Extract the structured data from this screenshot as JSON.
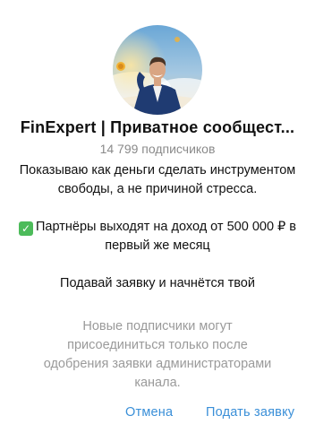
{
  "channel": {
    "title": "FinExpert | Приватное сообщест...",
    "subscribers": "14 799 подписчиков",
    "description": {
      "line1": "Показываю как деньги сделать инструментом свободы, а не причиной стресса.",
      "check_icon": "check-mark-icon",
      "line2": "Партнёры выходят на доход от 500 000 ₽ в первый же месяц",
      "line3": "Подавай заявку и начнётся твой"
    },
    "note": "Новые подписчики могут присоединиться только после одобрения заявки администраторами канала."
  },
  "actions": {
    "cancel_label": "Отмена",
    "apply_label": "Подать заявку"
  },
  "colors": {
    "accent": "#3a8fd8",
    "muted_text": "#8a8a8a",
    "check_bg": "#4cbb5a"
  }
}
